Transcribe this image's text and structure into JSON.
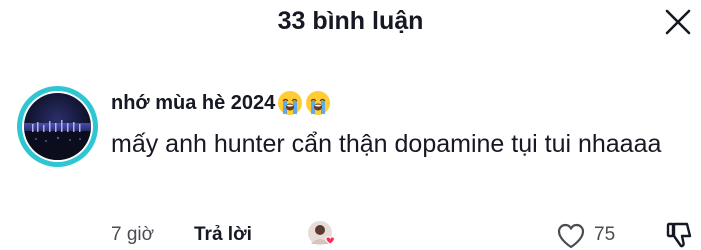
{
  "header": {
    "title": "33 bình luận",
    "close_icon": "close-icon"
  },
  "comment": {
    "username": "nhớ mùa hè 2024",
    "username_emojis": [
      "loudly-crying-face-emoji",
      "loudly-crying-face-emoji"
    ],
    "text": "mấy anh hunter cẩn thận dopamine tụi tui nhaaaa",
    "time": "7 giờ",
    "reply_label": "Trả lời",
    "like_count": "75",
    "avatar_ring_color": "#2ec6d3",
    "icons": {
      "like": "heart-outline-icon",
      "dislike": "thumbs-down-icon",
      "creator_liked": "creator-liked-avatar-icon"
    }
  }
}
